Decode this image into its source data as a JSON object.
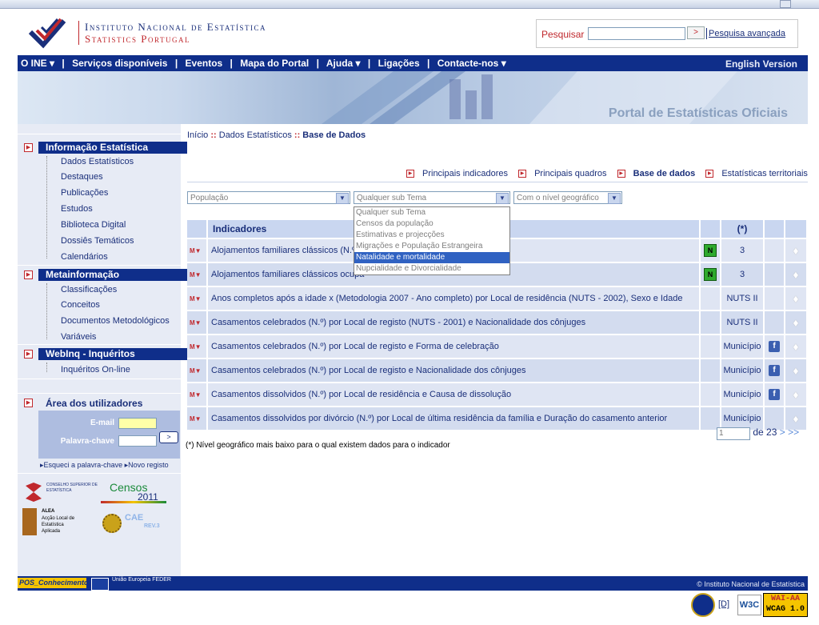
{
  "header": {
    "inst_line1": "Instituto Nacional de Estatística",
    "inst_line2": "Statistics Portugal",
    "search_label": "Pesquisar",
    "search_go": ">",
    "search_advanced": "Pesquisa avançada"
  },
  "nav": {
    "items": [
      "O INE ▾",
      "Serviços disponíveis",
      "Eventos",
      "Mapa do Portal",
      "Ajuda ▾",
      "Ligações",
      "Contacte-nos ▾"
    ],
    "separator": "|",
    "english": "English Version"
  },
  "banner": {
    "title": "Portal de Estatísticas Oficiais"
  },
  "sidebar": {
    "sections": [
      {
        "title": "Informação Estatística",
        "items": [
          "Dados Estatísticos",
          "Destaques",
          "Publicações",
          "Estudos",
          "Biblioteca Digital",
          "Dossiês Temáticos",
          "Calendários"
        ]
      },
      {
        "title": "Metainformação",
        "items": [
          "Classificações",
          "Conceitos",
          "Documentos Metodológicos",
          "Variáveis"
        ]
      },
      {
        "title": "WebInq - Inquéritos",
        "items": [
          "Inquéritos On-line"
        ]
      },
      {
        "title": "Área dos utilizadores",
        "items": []
      }
    ],
    "login": {
      "email_label": "E-mail",
      "password_label": "Palavra-chave",
      "go": ">"
    },
    "forgot": "Esqueci a palavra-chave",
    "register": "Novo registo",
    "logos": {
      "cse": "CONSELHO SUPERIOR DE ESTATÍSTICA",
      "censos": "Censos",
      "censos_year": "2011",
      "alea_title": "ALEA",
      "alea_text": "Acção Local de Estatística Aplicada",
      "cae": "CAE",
      "cae_rev": "REV.3"
    }
  },
  "breadcrumb": {
    "home": "Início",
    "sep": "::",
    "level2": "Dados Estatísticos",
    "current": "Base de Dados"
  },
  "tabs": [
    "Principais indicadores",
    "Principais quadros",
    "Base de dados",
    "Estatísticas territoriais"
  ],
  "filters": {
    "tema": "População",
    "subtema": "Qualquer sub Tema",
    "nivel": "Com o nível geográfico",
    "subtema_options": [
      "Qualquer sub Tema",
      "Censos da população",
      "Estimativas e projecções",
      "Migrações e População Estrangeira",
      "Natalidade e mortalidade",
      "Nupcialidade e Divorcialidade"
    ],
    "subtema_highlighted": "Natalidade e mortalidade"
  },
  "table": {
    "header": "Indicadores",
    "level_header": "(*)",
    "rows": [
      {
        "text": "Alojamentos familiares clássicos (N.º) p",
        "new": "N",
        "level": "3",
        "fb": ""
      },
      {
        "text": "Alojamentos familiares clássicos ocupa",
        "new": "N",
        "level": "3",
        "fb": ""
      },
      {
        "text": "Anos completos após a idade x (Metodologia 2007 - Ano completo) por Local de residência (NUTS - 2002), Sexo e Idade",
        "new": "",
        "level": "NUTS II",
        "fb": ""
      },
      {
        "text": "Casamentos celebrados (N.º) por Local de registo (NUTS - 2001) e Nacionalidade dos cônjuges",
        "new": "",
        "level": "NUTS II",
        "fb": ""
      },
      {
        "text": "Casamentos celebrados (N.º) por Local de registo e Forma de celebração",
        "new": "",
        "level": "Município",
        "fb": "f"
      },
      {
        "text": "Casamentos celebrados (N.º) por Local de registo e Nacionalidade dos cônjuges",
        "new": "",
        "level": "Município",
        "fb": "f"
      },
      {
        "text": "Casamentos dissolvidos (N.º) por Local de residência e Causa de dissolução",
        "new": "",
        "level": "Município",
        "fb": "f"
      },
      {
        "text": "Casamentos dissolvidos por divórcio (N.º) por Local de última residência da família e Duração do casamento anterior",
        "new": "",
        "level": "Município",
        "fb": ""
      }
    ]
  },
  "pager": {
    "page": "1",
    "of": "de 23",
    "next": ">",
    "last": ">>"
  },
  "note": "(*) Nível geográfico mais baixo para o qual existem dados para o indicador",
  "footer": {
    "copyright": "© Instituto Nacional de Estatística",
    "pos": "POS_Conhecimento",
    "eu": "União Europeia FEDER"
  },
  "badges": {
    "d": "[D]",
    "w3c": "W3C",
    "wai": "WAI-AA",
    "wcag": "WCAG 1.0"
  },
  "colors": {
    "navy": "#0f2e8a",
    "red": "#c0282d",
    "row": "#dfe5f3"
  }
}
